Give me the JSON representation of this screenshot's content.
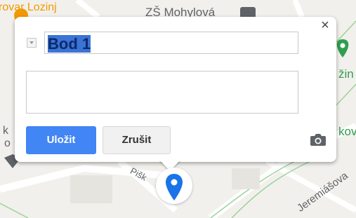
{
  "map": {
    "labels": {
      "top_left": "rovar Lozinj",
      "school": "ZŠ Mohylová",
      "right_top": "žin",
      "right_mid": "kov",
      "left_k": "k",
      "left_o": "o",
      "street_pisk": "Pišk",
      "street_jeremiasova": "Jeremiášova"
    }
  },
  "popup": {
    "title_value": "Bod 1",
    "description_value": "",
    "save_label": "Uložit",
    "cancel_label": "Zrušit",
    "close_glyph": "×"
  },
  "colors": {
    "save_button": "#4285f4",
    "marker": "#1a73e8",
    "selection": "#3b73d6"
  },
  "icons": {
    "close": "close-icon",
    "dropdown": "dropdown-icon",
    "camera": "camera-icon",
    "marker": "map-pin-icon"
  }
}
